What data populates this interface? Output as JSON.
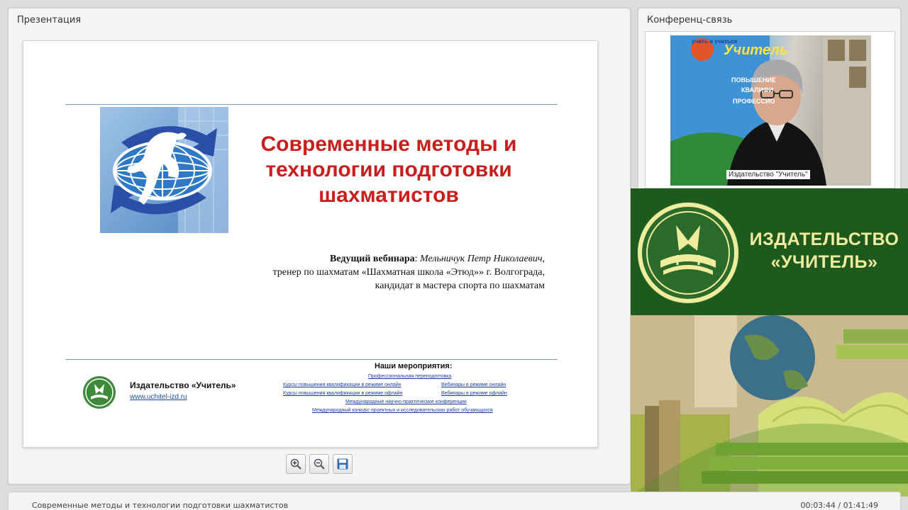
{
  "presentation_panel": {
    "title": "Презентация",
    "slide": {
      "title": "Современные методы и технологии подготовки шахматистов",
      "presenter_label": "Ведущий вебинара",
      "presenter_name": "Мельничук Петр Николаевич,",
      "presenter_line2": "тренер по шахматам «Шахматная школа «Этюд»» г. Волгограда,",
      "presenter_line3": "кандидат в мастера спорта по шахматам",
      "publisher_name": "Издательство «Учитель»",
      "publisher_url": "www.uchitel-izd.ru",
      "events_title": "Наши мероприятия",
      "events": [
        "Профессиональная переподготовка",
        "Курсы повышения квалификации в режиме онлайн",
        "Вебинары в режиме онлайн",
        "Курсы повышения квалификации в режиме офлайн",
        "Вебинары в режиме офлайн",
        "Международные научно-практические конференции",
        "Международный конкурс проектных и исследовательских работ обучающихся"
      ]
    },
    "toolbar": {
      "zoom_in_icon": "zoom-in-icon",
      "zoom_out_icon": "zoom-out-icon",
      "save_icon": "save-icon"
    }
  },
  "conference_panel": {
    "title": "Конференц-связь",
    "video_caption": "Издательство \"Учитель\"",
    "backdrop_text": {
      "top": "учить и учиться",
      "brand": "Учитель",
      "line1": "ПОВЫШЕНИЕ",
      "line2": "КВАЛИФИ",
      "line3": "ПРОФЕССИО"
    }
  },
  "banner": {
    "line1": "ИЗДАТЕЛЬСТВО",
    "line2": "«УЧИТЕЛЬ»"
  },
  "bottom_bar": {
    "webinar_title": "Современные методы и технологии подготовки шахматистов",
    "time": "00:03:44 / 01:41:49"
  },
  "colors": {
    "accent_red": "#c81e1e",
    "banner_green": "#1e5a1e",
    "banner_text": "#f0ec9e",
    "link_blue": "#1a4fa0"
  }
}
